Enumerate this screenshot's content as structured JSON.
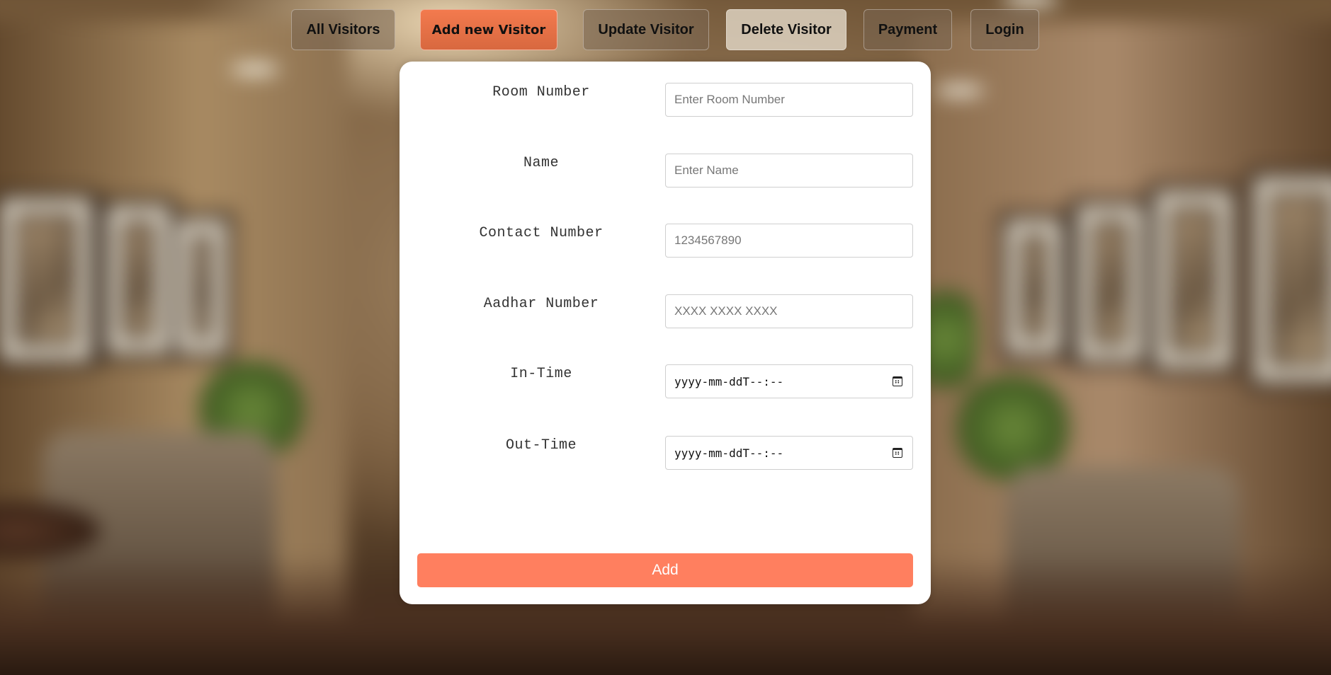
{
  "nav": {
    "items": [
      {
        "label": "All Visitors",
        "active": false
      },
      {
        "label": "Add new Visitor",
        "active": true
      },
      {
        "label": "Update Visitor",
        "active": false
      },
      {
        "label": "Delete Visitor",
        "active": false
      },
      {
        "label": "Payment",
        "active": false
      },
      {
        "label": "Login",
        "active": false
      }
    ]
  },
  "form": {
    "fields": [
      {
        "label": "Room Number",
        "placeholder": "Enter Room Number",
        "value": ""
      },
      {
        "label": "Name",
        "placeholder": "Enter Name",
        "value": ""
      },
      {
        "label": "Contact Number",
        "placeholder": "1234567890",
        "value": ""
      },
      {
        "label": "Aadhar Number",
        "placeholder": "XXXX XXXX XXXX",
        "value": ""
      },
      {
        "label": "In-Time",
        "display": "yyyy-mm-ddT--:--"
      },
      {
        "label": "Out-Time",
        "display": "yyyy-mm-ddT--:--"
      }
    ],
    "submit_label": "Add"
  },
  "colors": {
    "accent": "#ff7f5f",
    "active_nav": "#e8703f"
  },
  "icons": {
    "datetime_picker": "calendar-icon"
  }
}
